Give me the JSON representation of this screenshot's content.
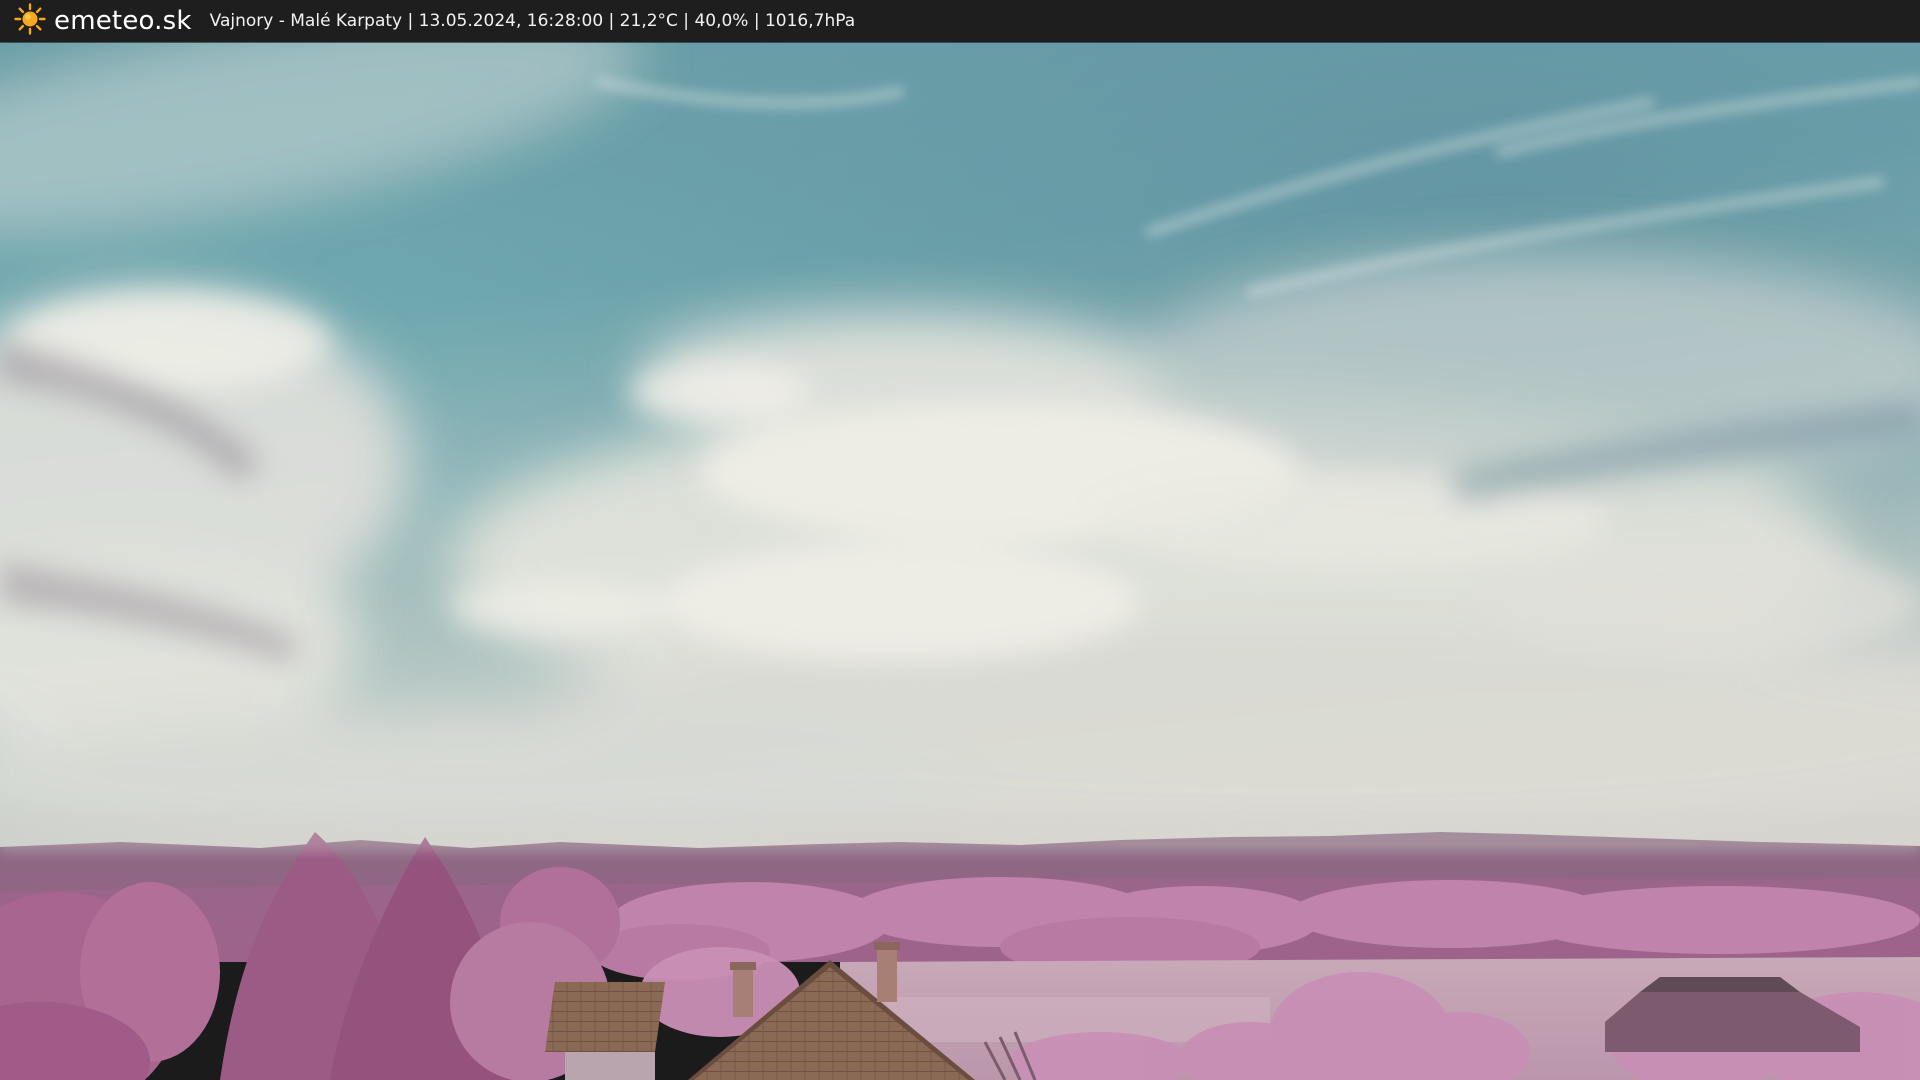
{
  "header": {
    "brand": "emeteo.sk",
    "logo_icon": "sun-icon",
    "caption": "Vajnory - Malé Karpaty | 13.05.2024, 16:28:00 | 21,2°C | 40,0% | 1016,7hPa"
  },
  "colors": {
    "bar": "#1e1e1e",
    "sun": "#f7a81b",
    "sky_top": "#5f9aa3",
    "sky_horizon": "#d4d7d2",
    "cloud": "#e6e6dc",
    "hills": "#8a5a78",
    "foliage": "#b57a9e",
    "field": "#c4a4b4",
    "roof": "#8a6a52"
  }
}
